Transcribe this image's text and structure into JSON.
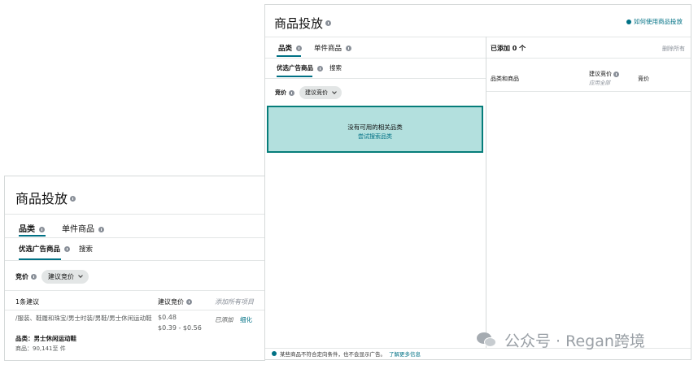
{
  "back_panel": {
    "title": "商品投放",
    "tabs": [
      "品类",
      "单件商品"
    ],
    "subtabs": [
      "优选广告商品",
      "搜索"
    ],
    "bid_label": "竞价",
    "bid_option": "建议竞价",
    "suggestion_count": "1条建议",
    "suggested_bid_header": "建议竞价",
    "add_all": "添加所有项目",
    "suggestion": {
      "path": "/服装、鞋履和珠宝/男士时装/男鞋/男士休闲运动鞋",
      "category": "品类：男士休闲运动鞋",
      "count": "商品：90,141至 件",
      "bid": "$0.48",
      "bid_range": "$0.39 - $0.56",
      "added": "已添加",
      "refine": "细化"
    }
  },
  "front_panel": {
    "title": "商品投放",
    "help_link": "如何使用商品投放",
    "tabs": [
      "品类",
      "单件商品"
    ],
    "subtabs": [
      "优选广告商品",
      "搜索"
    ],
    "bid_label": "竞价",
    "bid_option": "建议竞价",
    "empty_title": "没有可用的相关品类",
    "empty_link": "尝试搜索品类",
    "added_count": "已添加 0 个",
    "remove_all": "删除所有",
    "col_category": "品类和商品",
    "col_suggested": "建议竞价",
    "col_apply_all": "应用全部",
    "col_bid": "竞价",
    "footer_text": "某些商品不符合定向条件，也不会显示广告。",
    "footer_link": "了解更多信息"
  },
  "watermark": {
    "text": "公众号 · Regan跨境",
    "icon": "wechat-icon"
  },
  "colors": {
    "accent": "#007185",
    "empty_fill": "#b3e0de",
    "empty_border": "#067d7a"
  }
}
